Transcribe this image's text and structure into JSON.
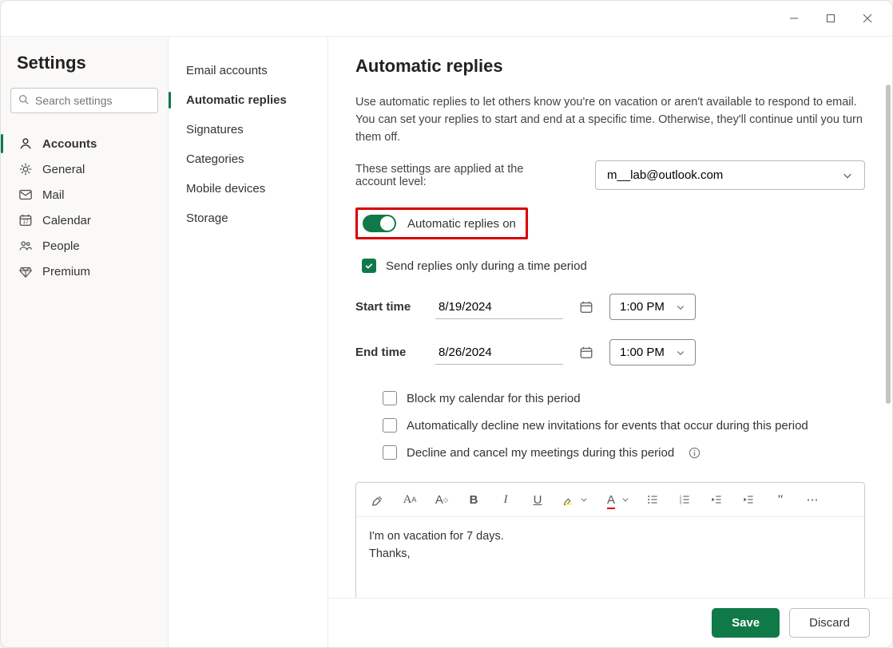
{
  "window_title": "Settings",
  "search_placeholder": "Search settings",
  "left_nav": [
    {
      "icon": "person",
      "label": "Accounts"
    },
    {
      "icon": "gear",
      "label": "General"
    },
    {
      "icon": "mail",
      "label": "Mail"
    },
    {
      "icon": "calendar",
      "label": "Calendar"
    },
    {
      "icon": "people",
      "label": "People"
    },
    {
      "icon": "diamond",
      "label": "Premium"
    }
  ],
  "mid_nav": [
    {
      "label": "Email accounts"
    },
    {
      "label": "Automatic replies"
    },
    {
      "label": "Signatures"
    },
    {
      "label": "Categories"
    },
    {
      "label": "Mobile devices"
    },
    {
      "label": "Storage"
    }
  ],
  "page_heading": "Automatic replies",
  "description": "Use automatic replies to let others know you're on vacation or aren't available to respond to email. You can set your replies to start and end at a specific time. Otherwise, they'll continue until you turn them off.",
  "account_label": "These settings are applied at the account level:",
  "account_selected": "m__lab@outlook.com",
  "toggle_label": "Automatic replies on",
  "time_period_label": "Send replies only during a time period",
  "start_time_label": "Start time",
  "start_date": "8/19/2024",
  "start_time": "1:00 PM",
  "end_time_label": "End time",
  "end_date": "8/26/2024",
  "end_time": "1:00 PM",
  "opt_block": "Block my calendar for this period",
  "opt_decline_new": "Automatically decline new invitations for events that occur during this period",
  "opt_cancel": "Decline and cancel my meetings during this period",
  "reply_body": "I'm on vacation for 7 days.\nThanks,",
  "save_label": "Save",
  "discard_label": "Discard"
}
